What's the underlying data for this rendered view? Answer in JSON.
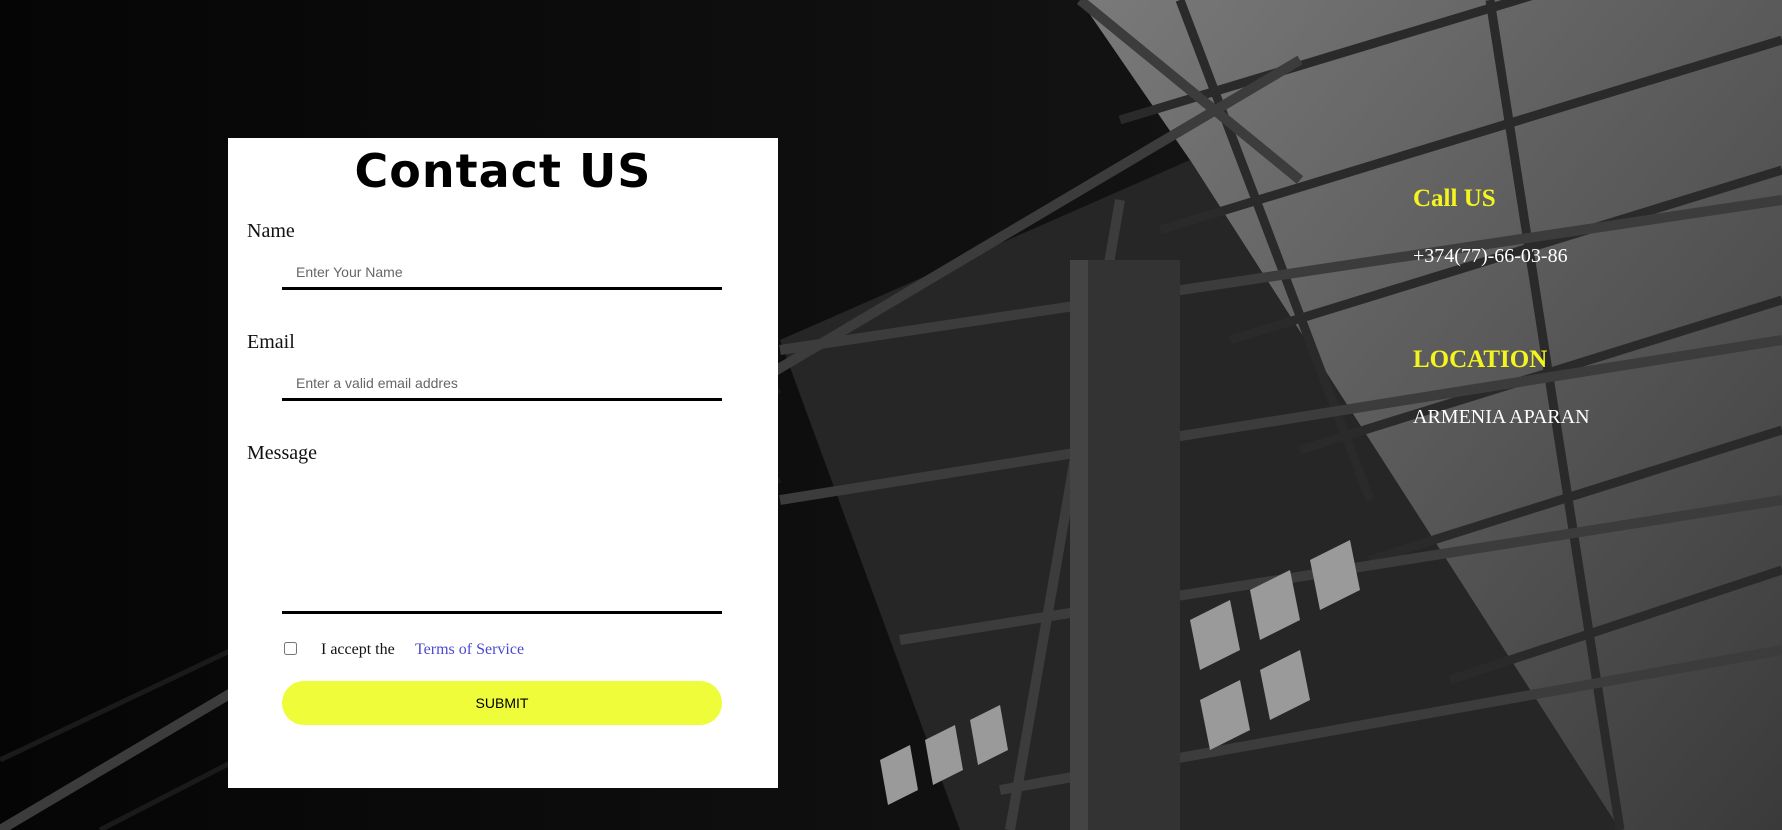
{
  "form": {
    "title": "Contact US",
    "name_label": "Name",
    "name_placeholder": "Enter Your Name",
    "name_value": "",
    "email_label": "Email",
    "email_placeholder": "Enter a valid email addres",
    "email_value": "",
    "message_label": "Message",
    "message_value": "",
    "accept_text": "I accept the",
    "terms_link": "Terms of Service",
    "terms_checked": false,
    "submit_label": "SUBMIT"
  },
  "info": {
    "call_heading": "Call US",
    "phone": "+374(77)-66-03-86",
    "location_heading": "LOCATION",
    "location": "ARMENIA APARAN"
  },
  "colors": {
    "accent_yellow": "#eefc3a",
    "heading_yellow": "#f4f41e",
    "link_blue": "#4a4acf",
    "background": "#0a0a0a"
  }
}
